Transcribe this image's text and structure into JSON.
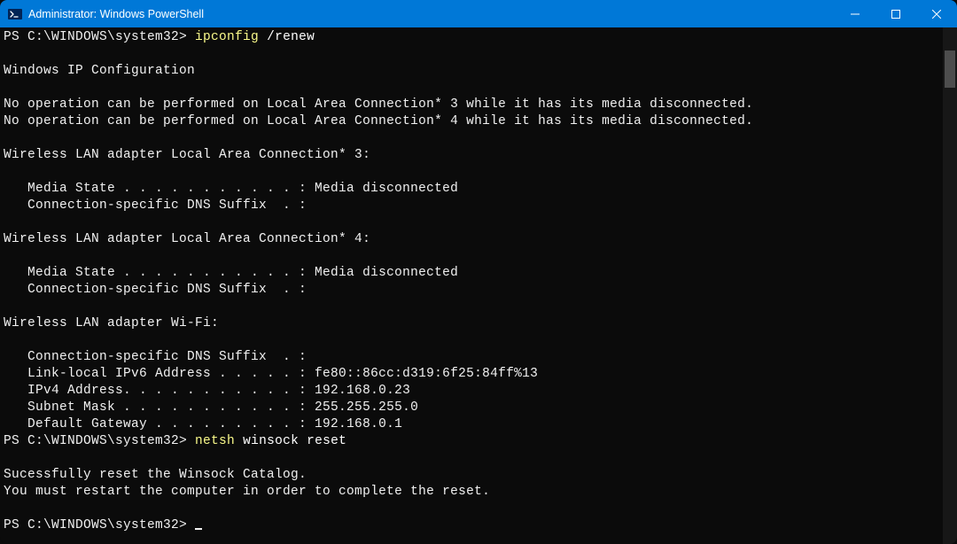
{
  "window": {
    "title": "Administrator: Windows PowerShell"
  },
  "terminal": {
    "prompt": "PS C:\\WINDOWS\\system32> ",
    "cmd1_a": "ipconfig ",
    "cmd1_b": "/renew",
    "blank": "",
    "line_winip": "Windows IP Configuration",
    "line_noop3": "No operation can be performed on Local Area Connection* 3 while it has its media disconnected.",
    "line_noop4": "No operation can be performed on Local Area Connection* 4 while it has its media disconnected.",
    "line_wlan3": "Wireless LAN adapter Local Area Connection* 3:",
    "line_media3": "   Media State . . . . . . . . . . . : Media disconnected",
    "line_dns3": "   Connection-specific DNS Suffix  . :",
    "line_wlan4": "Wireless LAN adapter Local Area Connection* 4:",
    "line_media4": "   Media State . . . . . . . . . . . : Media disconnected",
    "line_dns4": "   Connection-specific DNS Suffix  . :",
    "line_wifi": "Wireless LAN adapter Wi-Fi:",
    "line_wifi_dns": "   Connection-specific DNS Suffix  . :",
    "line_wifi_ipv6": "   Link-local IPv6 Address . . . . . : fe80::86cc:d319:6f25:84ff%13",
    "line_wifi_ipv4": "   IPv4 Address. . . . . . . . . . . : 192.168.0.23",
    "line_wifi_mask": "   Subnet Mask . . . . . . . . . . . : 255.255.255.0",
    "line_wifi_gw": "   Default Gateway . . . . . . . . . : 192.168.0.1",
    "cmd2_a": "netsh ",
    "cmd2_b": "winsock reset",
    "line_reset1": "Sucessfully reset the Winsock Catalog.",
    "line_reset2": "You must restart the computer in order to complete the reset."
  }
}
